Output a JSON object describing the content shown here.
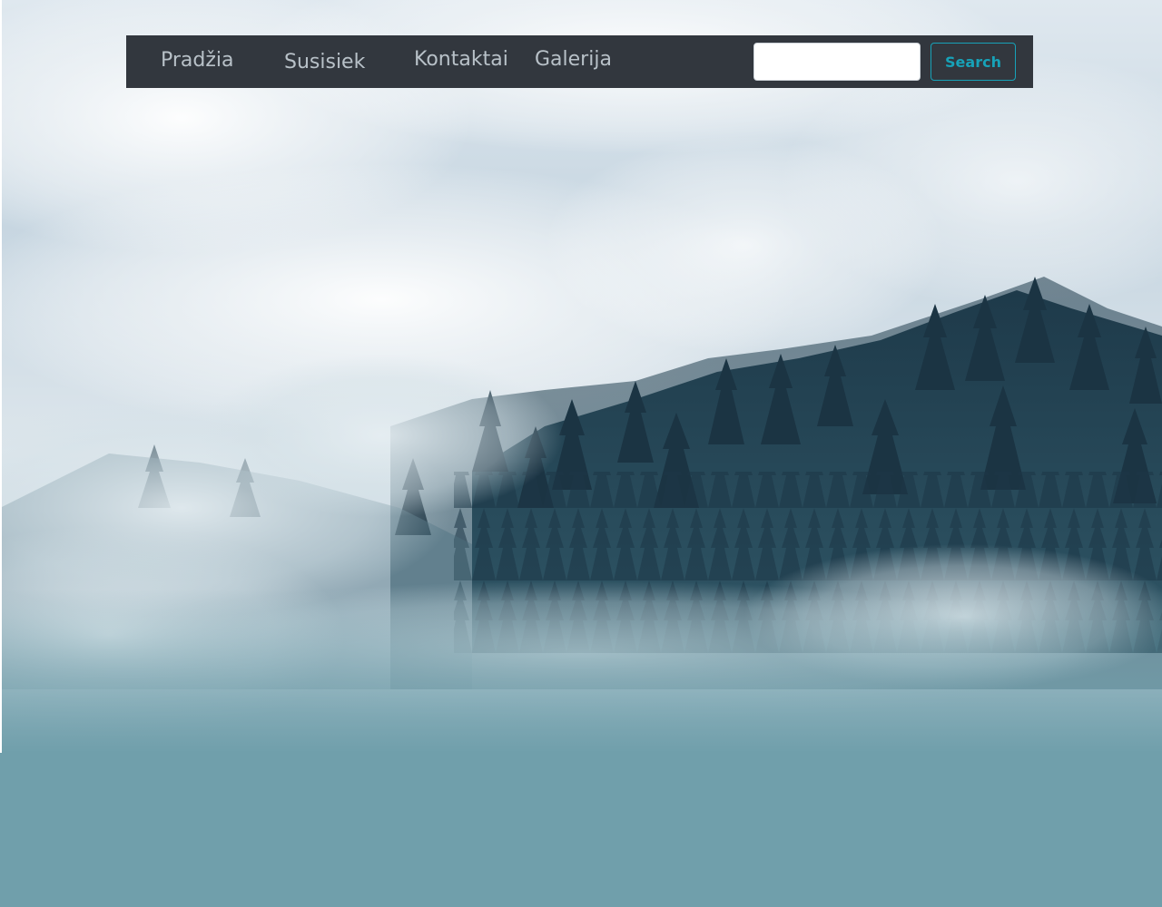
{
  "nav": {
    "links": [
      {
        "label": "Pradžia"
      },
      {
        "label": "Susisiek"
      },
      {
        "label": "Kontaktai"
      },
      {
        "label": "Galerija"
      }
    ]
  },
  "search": {
    "value": "",
    "placeholder": "",
    "button_label": "Search"
  },
  "colors": {
    "navbar_bg": "#32373e",
    "nav_link": "#b8c1c8",
    "search_accent": "#17a2b8",
    "page_bottom": "#709fab"
  },
  "hero": {
    "image_subject": "misty-pine-forest-image"
  }
}
